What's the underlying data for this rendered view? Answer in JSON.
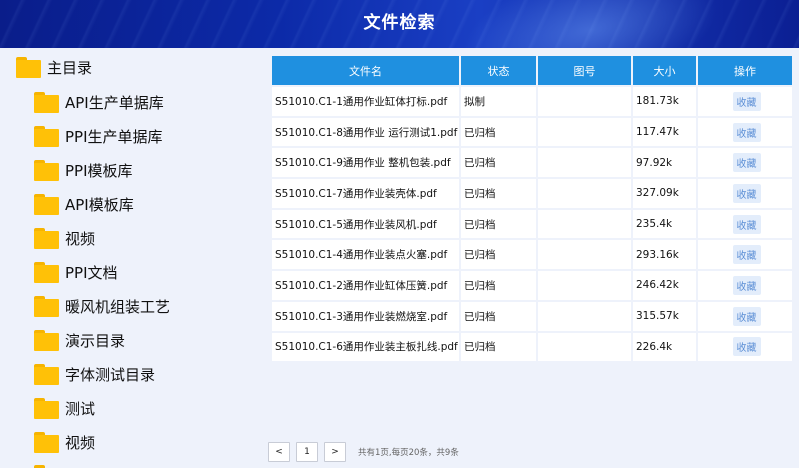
{
  "header": {
    "title": "文件检索"
  },
  "sidebar": {
    "root": "主目录",
    "items": [
      "API生产单据库",
      "PPI生产单据库",
      "PPI模板库",
      "API模板库",
      "视频",
      "PPI文档",
      "暖风机组装工艺",
      "演示目录",
      "字体测试目录",
      "测试",
      "视频"
    ]
  },
  "table": {
    "headers": {
      "name": "文件名",
      "status": "状态",
      "code": "图号",
      "size": "大小",
      "op": "操作"
    },
    "rows": [
      {
        "name": "S51010.C1-1通用作业缸体打标.pdf",
        "status": "拟制",
        "code": "",
        "size": "181.73k",
        "op": "收藏"
      },
      {
        "name": "S51010.C1-8通用作业 运行测试1.pdf",
        "status": "已归档",
        "code": "",
        "size": "117.47k",
        "op": "收藏"
      },
      {
        "name": "S51010.C1-9通用作业 整机包装.pdf",
        "status": "已归档",
        "code": "",
        "size": "97.92k",
        "op": "收藏"
      },
      {
        "name": "S51010.C1-7通用作业装壳体.pdf",
        "status": "已归档",
        "code": "",
        "size": "327.09k",
        "op": "收藏"
      },
      {
        "name": "S51010.C1-5通用作业装风机.pdf",
        "status": "已归档",
        "code": "",
        "size": "235.4k",
        "op": "收藏"
      },
      {
        "name": "S51010.C1-4通用作业装点火塞.pdf",
        "status": "已归档",
        "code": "",
        "size": "293.16k",
        "op": "收藏"
      },
      {
        "name": "S51010.C1-2通用作业缸体压簧.pdf",
        "status": "已归档",
        "code": "",
        "size": "246.42k",
        "op": "收藏"
      },
      {
        "name": "S51010.C1-3通用作业装燃烧室.pdf",
        "status": "已归档",
        "code": "",
        "size": "315.57k",
        "op": "收藏"
      },
      {
        "name": "S51010.C1-6通用作业装主板扎线.pdf",
        "status": "已归档",
        "code": "",
        "size": "226.4k",
        "op": "收藏"
      }
    ]
  },
  "pager": {
    "prev": "<",
    "page": "1",
    "next": ">",
    "info": "共有1页,每页20条，共9条"
  },
  "colors": {
    "header_bg": "#0c2aa8",
    "table_header": "#1f90e0",
    "folder": "#ffc107",
    "link": "#5c8fd6"
  }
}
